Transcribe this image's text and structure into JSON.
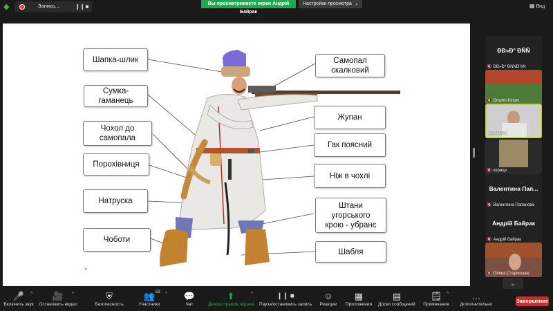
{
  "topbar": {
    "shield_icon": "shield-check-icon",
    "recording_label": "Запись...",
    "share_banner": "Вы просматриваете экран Андрій Байрак",
    "view_settings": "Настройки просмотра",
    "view_button": "Вид"
  },
  "slide": {
    "labels_left": [
      "Шапка-шлик",
      "Сумка-\nгаманець",
      "Чохол до\nсамопала",
      "Порохівниця",
      "Натруска",
      "Чоботи"
    ],
    "labels_right": [
      "Самопал\nскалковий",
      "Жупан",
      "Гак поясний",
      "Ніж в чохлі",
      "Штани\nугорського\nкрою - убранє",
      "Шабля"
    ]
  },
  "participants": [
    {
      "big_name": "ÐÐ»Ð° ÐÑÑ",
      "sub_name": "ÐÐ»Ð° ÐÑÑÐ½Ñ",
      "muted": true,
      "has_video": false
    },
    {
      "big_name": "",
      "sub_name": "Dmytro Kirsov",
      "muted": true,
      "has_video": true
    },
    {
      "big_name": "",
      "sub_name": "Ivan Revin",
      "muted": false,
      "has_video": true
    },
    {
      "big_name": "",
      "sub_name": "кориця",
      "muted": true,
      "has_video": true
    },
    {
      "big_name": "Валентина Пап...",
      "sub_name": "Валентина Папанова",
      "muted": true,
      "has_video": false
    },
    {
      "big_name": "Андрій Байрак",
      "sub_name": "Андрій Байрак",
      "muted": true,
      "has_video": false
    },
    {
      "big_name": "",
      "sub_name": "Олена Старинська",
      "muted": true,
      "has_video": true
    }
  ],
  "toolbar": {
    "mic": "Включить звук",
    "video": "Остановить видео",
    "security": "Безопасность",
    "participants": "Участники",
    "participants_count": "53",
    "chat": "Чат",
    "share": "Демонстрация экрана",
    "pause_record": "Пауза/остановить запись",
    "reactions": "Реакции",
    "apps": "Приложения",
    "whiteboard": "Доски сообщений",
    "notes": "Примечания",
    "more": "Дополнительно",
    "end": "Завершение"
  },
  "colors": {
    "share_green": "#1fa84f",
    "end_red": "#c9302c",
    "active_speaker": "#c9d13b"
  }
}
